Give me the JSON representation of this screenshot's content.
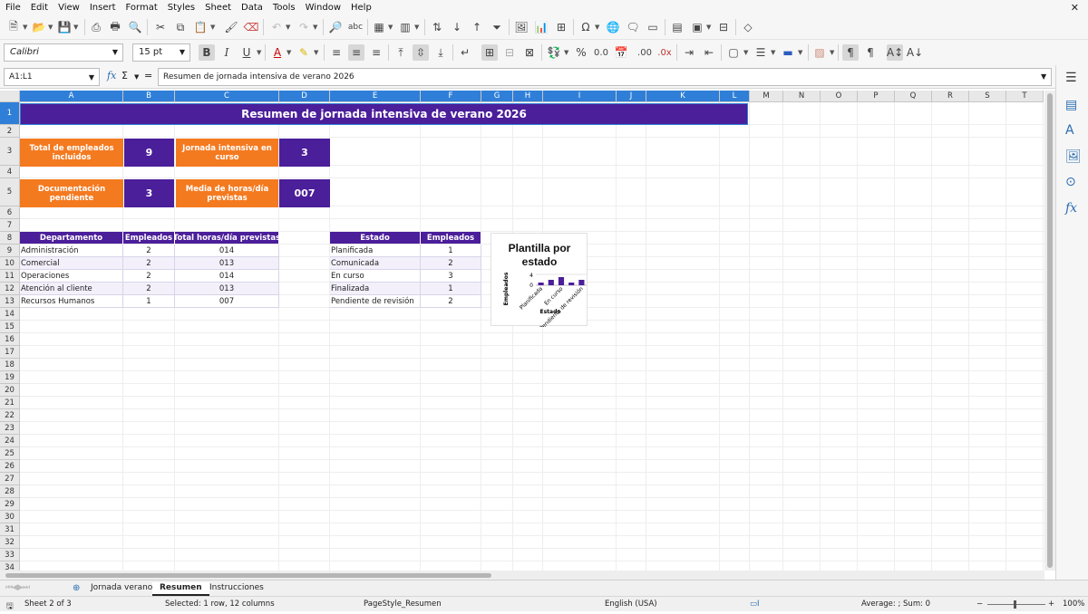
{
  "menu": [
    "File",
    "Edit",
    "View",
    "Insert",
    "Format",
    "Styles",
    "Sheet",
    "Data",
    "Tools",
    "Window",
    "Help"
  ],
  "font": {
    "name": "Calibri",
    "size": "15 pt"
  },
  "formula_bar": {
    "name_box": "A1:L1",
    "content": "Resumen de jornada intensiva de verano 2026"
  },
  "columns": [
    "A",
    "B",
    "C",
    "D",
    "E",
    "F",
    "G",
    "H",
    "I",
    "J",
    "K",
    "L",
    "M",
    "N",
    "O",
    "P",
    "Q",
    "R",
    "S",
    "T"
  ],
  "rows": [
    "1",
    "2",
    "3",
    "4",
    "5",
    "6",
    "7",
    "8",
    "9",
    "10",
    "11",
    "12",
    "13",
    "14",
    "15",
    "16",
    "17",
    "18",
    "19",
    "20",
    "21",
    "22",
    "23",
    "24",
    "25",
    "26",
    "27",
    "28",
    "29",
    "30",
    "31",
    "32",
    "33",
    "34"
  ],
  "sheet": {
    "title": "Resumen de jornada intensiva de verano 2026",
    "kpi": {
      "total_label": "Total de empleados incluidos",
      "total_value": "9",
      "jornada_label": "Jornada intensiva en curso",
      "jornada_value": "3",
      "doc_label": "Documentación pendiente",
      "doc_value": "3",
      "media_label": "Media de horas/día previstas",
      "media_value": "007"
    },
    "dept_table": {
      "headers": [
        "Departamento",
        "Empleados",
        "Total horas/día previstas"
      ],
      "rows": [
        [
          "Administración",
          "2",
          "014"
        ],
        [
          "Comercial",
          "2",
          "013"
        ],
        [
          "Operaciones",
          "2",
          "014"
        ],
        [
          "Atención al cliente",
          "2",
          "013"
        ],
        [
          "Recursos Humanos",
          "1",
          "007"
        ]
      ]
    },
    "estado_table": {
      "headers": [
        "Estado",
        "Empleados"
      ],
      "rows": [
        [
          "Planificada",
          "1"
        ],
        [
          "Comunicada",
          "2"
        ],
        [
          "En curso",
          "3"
        ],
        [
          "Finalizada",
          "1"
        ],
        [
          "Pendiente de revisión",
          "2"
        ]
      ]
    }
  },
  "chart_data": {
    "type": "bar",
    "title": "Plantilla por estado",
    "xlabel": "Estado",
    "ylabel": "Empleados",
    "categories": [
      "Planificada",
      "Comunicada",
      "En curso",
      "Finalizada",
      "Pendiente de revisión"
    ],
    "tick_labels": [
      "Planificada",
      "En curso",
      "Pendiente de revisión"
    ],
    "values": [
      1,
      2,
      3,
      1,
      2
    ],
    "y_ticks": [
      "4",
      "0"
    ],
    "ylim": [
      0,
      4
    ],
    "bar_color": "#4b1e9a"
  },
  "sheet_tabs": [
    "Jornada verano",
    "Resumen",
    "Instrucciones"
  ],
  "status_bar": {
    "sheet": "Sheet 2 of 3",
    "selection": "Selected: 1 row, 12 columns",
    "page_style": "PageStyle_Resumen",
    "language": "English (USA)",
    "sum": "Average: ; Sum: 0",
    "zoom": "100%"
  }
}
